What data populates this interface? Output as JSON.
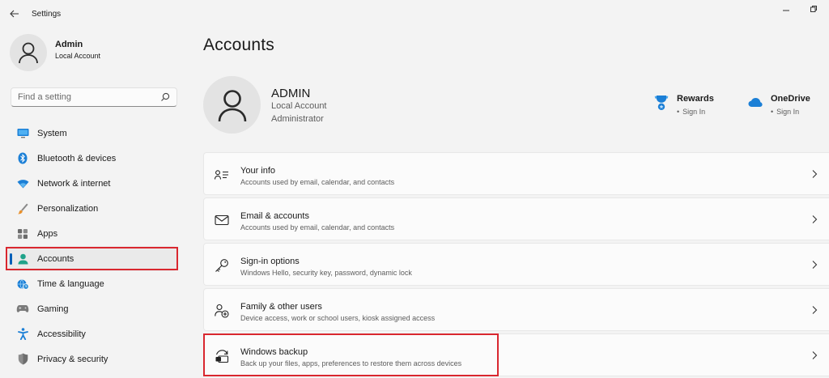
{
  "window": {
    "title": "Settings"
  },
  "profile": {
    "name": "Admin",
    "account_type": "Local Account"
  },
  "search": {
    "placeholder": "Find a setting"
  },
  "nav": [
    {
      "label": "System",
      "icon": "monitor-icon"
    },
    {
      "label": "Bluetooth & devices",
      "icon": "bluetooth-icon"
    },
    {
      "label": "Network & internet",
      "icon": "wifi-icon"
    },
    {
      "label": "Personalization",
      "icon": "brush-icon"
    },
    {
      "label": "Apps",
      "icon": "apps-icon"
    },
    {
      "label": "Accounts",
      "icon": "person-icon",
      "selected": true
    },
    {
      "label": "Time & language",
      "icon": "globe-clock-icon"
    },
    {
      "label": "Gaming",
      "icon": "gamepad-icon"
    },
    {
      "label": "Accessibility",
      "icon": "accessibility-icon"
    },
    {
      "label": "Privacy & security",
      "icon": "shield-icon"
    }
  ],
  "page": {
    "title": "Accounts"
  },
  "account": {
    "name": "ADMIN",
    "type": "Local Account",
    "role": "Administrator"
  },
  "services": {
    "rewards": {
      "name": "Rewards",
      "link": "Sign In",
      "icon": "trophy-icon"
    },
    "onedrive": {
      "name": "OneDrive",
      "link": "Sign In",
      "icon": "cloud-icon"
    }
  },
  "cards": [
    {
      "title": "Your info",
      "desc": "Accounts used by email, calendar, and contacts",
      "icon": "person-card-icon"
    },
    {
      "title": "Email & accounts",
      "desc": "Accounts used by email, calendar, and contacts",
      "icon": "mail-icon"
    },
    {
      "title": "Sign-in options",
      "desc": "Windows Hello, security key, password, dynamic lock",
      "icon": "key-icon"
    },
    {
      "title": "Family & other users",
      "desc": "Device access, work or school users, kiosk assigned access",
      "icon": "add-users-icon"
    },
    {
      "title": "Windows backup",
      "desc": "Back up your files, apps, preferences to restore them across devices",
      "icon": "backup-icon"
    }
  ],
  "colors": {
    "accent": "#005fb8",
    "highlight_box": "#d9272f",
    "window_bg": "#f3f3f3",
    "card_bg": "#fbfbfb"
  }
}
